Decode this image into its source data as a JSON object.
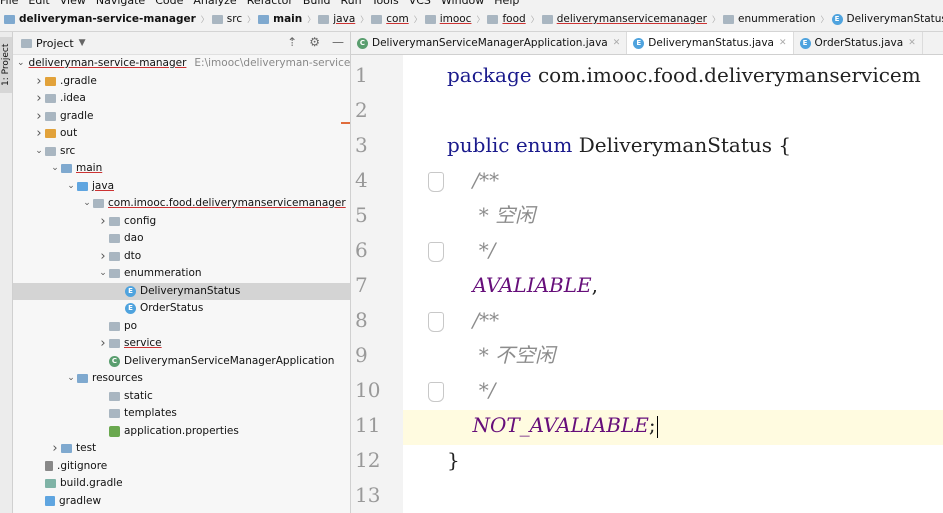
{
  "menu": [
    "File",
    "Edit",
    "View",
    "Navigate",
    "Code",
    "Analyze",
    "Refactor",
    "Build",
    "Run",
    "Tools",
    "VCS",
    "Window",
    "Help"
  ],
  "breadcrumbs": [
    {
      "label": "deliveryman-service-manager",
      "icon": "module-folder-icon",
      "bold": true
    },
    {
      "label": "src",
      "icon": "folder-icon"
    },
    {
      "label": "main",
      "icon": "source-folder-icon",
      "bold": true
    },
    {
      "label": "java",
      "icon": "folder-icon",
      "underline": true
    },
    {
      "label": "com",
      "icon": "package-icon",
      "underline": true
    },
    {
      "label": "imooc",
      "icon": "package-icon",
      "underline": true
    },
    {
      "label": "food",
      "icon": "package-icon",
      "underline": true
    },
    {
      "label": "deliverymanservicemanager",
      "icon": "package-icon",
      "underline": true
    },
    {
      "label": "enummeration",
      "icon": "package-icon"
    },
    {
      "label": "DeliverymanStatus",
      "icon": "enum-icon"
    }
  ],
  "sidebar_tab": "1: Project",
  "project_panel": {
    "title": "Project",
    "tree": [
      {
        "label": "deliveryman-service-manager",
        "path": "E:\\imooc\\deliveryman-service-r",
        "depth": 0,
        "arrow": "down",
        "icon": "module",
        "underline": true
      },
      {
        "label": ".gradle",
        "depth": 1,
        "arrow": "right",
        "icon": "orange"
      },
      {
        "label": ".idea",
        "depth": 1,
        "arrow": "right",
        "icon": "folder"
      },
      {
        "label": "gradle",
        "depth": 1,
        "arrow": "right",
        "icon": "folder"
      },
      {
        "label": "out",
        "depth": 1,
        "arrow": "right",
        "icon": "orange"
      },
      {
        "label": "src",
        "depth": 1,
        "arrow": "down",
        "icon": "folder"
      },
      {
        "label": "main",
        "depth": 2,
        "arrow": "down",
        "icon": "module",
        "underline": true
      },
      {
        "label": "java",
        "depth": 3,
        "arrow": "down",
        "icon": "blue",
        "underline": true
      },
      {
        "label": "com.imooc.food.deliverymanservicemanager",
        "depth": 4,
        "arrow": "down",
        "icon": "folder",
        "underline": true
      },
      {
        "label": "config",
        "depth": 5,
        "arrow": "right",
        "icon": "folder"
      },
      {
        "label": "dao",
        "depth": 5,
        "arrow": "",
        "icon": "folder"
      },
      {
        "label": "dto",
        "depth": 5,
        "arrow": "right",
        "icon": "folder"
      },
      {
        "label": "enummeration",
        "depth": 5,
        "arrow": "down",
        "icon": "folder"
      },
      {
        "label": "DeliverymanStatus",
        "depth": 6,
        "arrow": "",
        "icon": "enum",
        "selected": true
      },
      {
        "label": "OrderStatus",
        "depth": 6,
        "arrow": "",
        "icon": "enum"
      },
      {
        "label": "po",
        "depth": 5,
        "arrow": "",
        "icon": "folder"
      },
      {
        "label": "service",
        "depth": 5,
        "arrow": "right",
        "icon": "folder",
        "underline": true
      },
      {
        "label": "DeliverymanServiceManagerApplication",
        "depth": 5,
        "arrow": "",
        "icon": "app"
      },
      {
        "label": "resources",
        "depth": 3,
        "arrow": "down",
        "icon": "resources"
      },
      {
        "label": "static",
        "depth": 5,
        "arrow": "",
        "icon": "folder"
      },
      {
        "label": "templates",
        "depth": 5,
        "arrow": "",
        "icon": "folder"
      },
      {
        "label": "application.properties",
        "depth": 5,
        "arrow": "",
        "icon": "props"
      },
      {
        "label": "test",
        "depth": 2,
        "arrow": "right",
        "icon": "module"
      },
      {
        "label": ".gitignore",
        "depth": 1,
        "arrow": "",
        "icon": "file"
      },
      {
        "label": "build.gradle",
        "depth": 1,
        "arrow": "",
        "icon": "gradle"
      },
      {
        "label": "gradlew",
        "depth": 1,
        "arrow": "",
        "icon": "gradlew"
      }
    ]
  },
  "editor_tabs": [
    {
      "label": "DeliverymanServiceManagerApplication.java",
      "icon": "app",
      "active": false
    },
    {
      "label": "DeliverymanStatus.java",
      "icon": "enum",
      "active": true
    },
    {
      "label": "OrderStatus.java",
      "icon": "enum",
      "active": false
    }
  ],
  "line_numbers": [
    "1",
    "2",
    "3",
    "4",
    "5",
    "6",
    "7",
    "8",
    "9",
    "10",
    "11",
    "12",
    "13"
  ],
  "code_lines": [
    {
      "indent": "",
      "segments": [
        {
          "t": "package ",
          "c": "kw"
        },
        {
          "t": "com.imooc.food.deliverymanservicem",
          "c": "plain"
        }
      ]
    },
    {
      "indent": "",
      "segments": []
    },
    {
      "indent": "",
      "segments": [
        {
          "t": "public enum ",
          "c": "kw"
        },
        {
          "t": "DeliverymanStatus {",
          "c": "plain"
        }
      ]
    },
    {
      "indent": "    ",
      "segments": [
        {
          "t": "/**",
          "c": "cmt"
        }
      ]
    },
    {
      "indent": "     ",
      "segments": [
        {
          "t": "* 空闲",
          "c": "cmt"
        }
      ]
    },
    {
      "indent": "     ",
      "segments": [
        {
          "t": "*/",
          "c": "cmt"
        }
      ]
    },
    {
      "indent": "    ",
      "segments": [
        {
          "t": "AVALIABLE",
          "c": "enumc"
        },
        {
          "t": ",",
          "c": "plain"
        }
      ]
    },
    {
      "indent": "    ",
      "segments": [
        {
          "t": "/**",
          "c": "cmt"
        }
      ]
    },
    {
      "indent": "     ",
      "segments": [
        {
          "t": "* 不空闲",
          "c": "cmt"
        }
      ]
    },
    {
      "indent": "     ",
      "segments": [
        {
          "t": "*/",
          "c": "cmt"
        }
      ]
    },
    {
      "indent": "    ",
      "segments": [
        {
          "t": "NOT_AVALIABLE",
          "c": "enumc"
        },
        {
          "t": ";",
          "c": "plain"
        }
      ],
      "caret": true
    },
    {
      "indent": "",
      "segments": [
        {
          "t": "}",
          "c": "plain"
        }
      ]
    },
    {
      "indent": "",
      "segments": []
    }
  ]
}
